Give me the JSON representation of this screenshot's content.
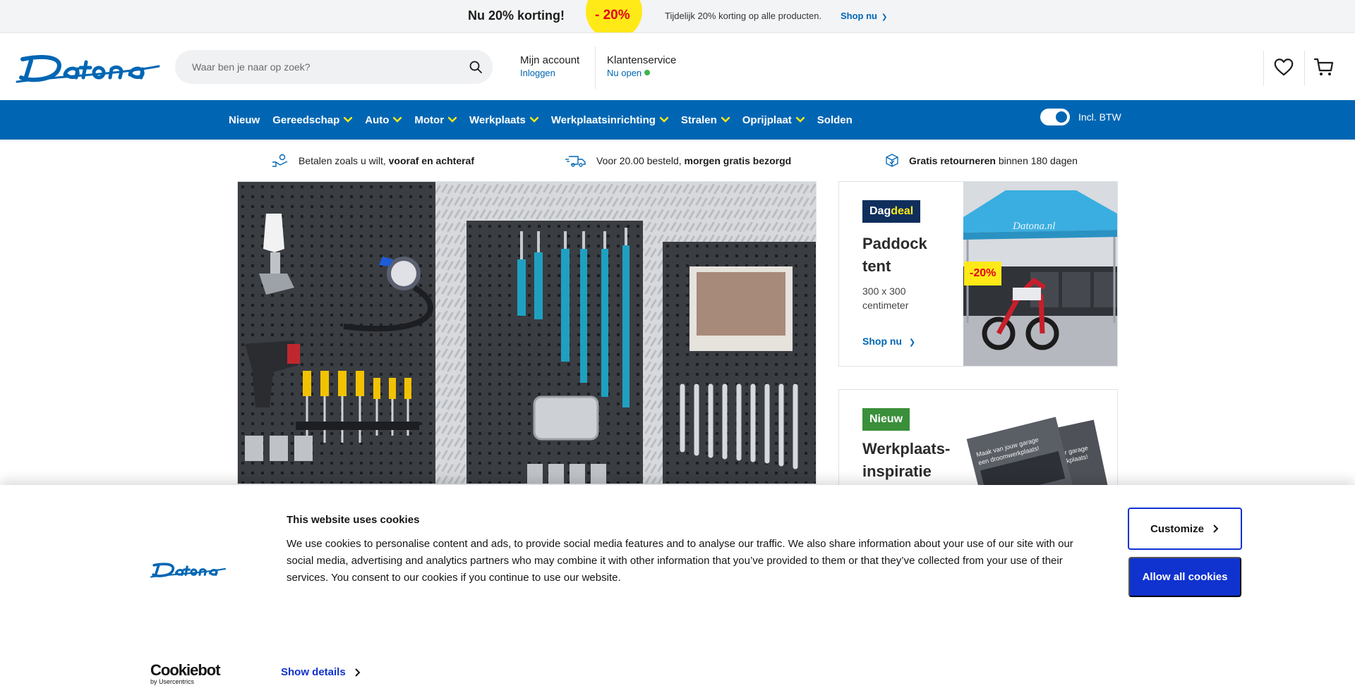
{
  "promo": {
    "title": "Nu 20% korting!",
    "badge": "- 20%",
    "description": "Tijdelijk 20% korting op alle producten.",
    "link": "Shop nu",
    "link_arrow": "❯"
  },
  "header": {
    "logo_text": "Datona",
    "search_placeholder": "Waar ben je naar op zoek?",
    "account_title": "Mijn account",
    "account_sub": "Inloggen",
    "service_title": "Klantenservice",
    "service_sub": "Nu open"
  },
  "nav": {
    "items": [
      {
        "label": "Nieuw"
      },
      {
        "label": "Gereedschap"
      },
      {
        "label": "Auto"
      },
      {
        "label": "Motor"
      },
      {
        "label": "Werkplaats"
      },
      {
        "label": "Werkplaatsinrichting"
      },
      {
        "label": "Stralen"
      },
      {
        "label": "Oprijplaat"
      },
      {
        "label": "Solden"
      }
    ],
    "vat_label": "Incl. BTW"
  },
  "usp": {
    "pay_pre": "Betalen zoals u wilt, ",
    "pay_bold": "vooraf en achteraf",
    "ship_pre": "Voor 20.00 besteld, ",
    "ship_bold": "morgen gratis bezorgd",
    "ret_bold": "Gratis retourneren",
    "ret_post": " binnen 180 dagen"
  },
  "deal": {
    "badge_a": "Dag",
    "badge_b": "deal",
    "title_l1": "Paddock",
    "title_l2": "tent",
    "subtitle": "300 x 300 centimeter",
    "link": "Shop nu",
    "link_arrow": "❯",
    "discount": "-20%",
    "tent_logo": "Datona.nl"
  },
  "new_card": {
    "badge": "Nieuw",
    "title_l1": "Werkplaats-",
    "title_l2": "inspiratie",
    "catalog_line1": "Maak van jouw garage",
    "catalog_line2": "een droomwerkplaats!",
    "catalog_back1": "r garage",
    "catalog_back2": "kplaats!"
  },
  "cookie": {
    "title": "This website uses cookies",
    "text": "We use cookies to personalise content and ads, to provide social media features and to analyse our traffic. We also share information about your use of our site with our social media, advertising and analytics partners who may combine it with other information that you’ve provided to them or that they’ve collected from your use of their services. You consent to our cookies if you continue to use our website.",
    "customize": "Customize",
    "allow_all": "Allow all cookies",
    "brand_name": "Cookiebot",
    "brand_by": "by Usercentrics",
    "show_details": "Show details"
  },
  "colors": {
    "brand_blue": "#0066b3",
    "promo_yellow": "#ffe917",
    "cookie_blue": "#1032cf",
    "status_green": "#3cb64b"
  }
}
